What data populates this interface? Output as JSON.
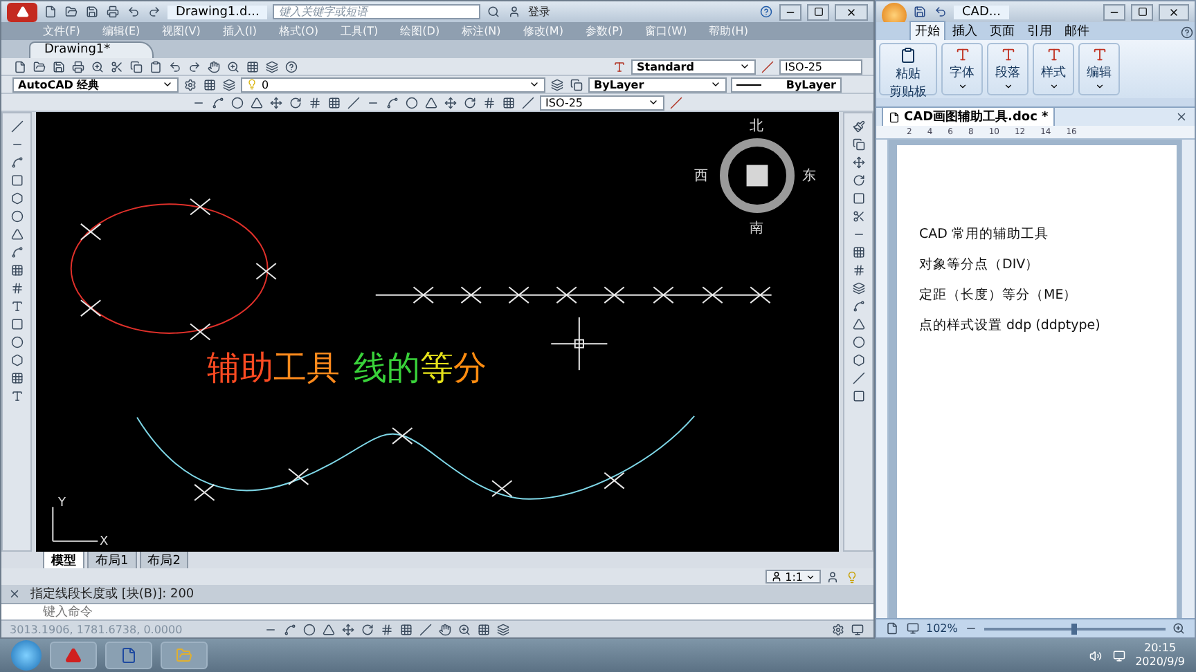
{
  "cad_window": {
    "title": "Drawing1.d...",
    "search": {
      "placeholder": "键入关键字或短语"
    },
    "login": "登录",
    "menu": [
      "文件(F)",
      "编辑(E)",
      "视图(V)",
      "插入(I)",
      "格式(O)",
      "工具(T)",
      "绘图(D)",
      "标注(N)",
      "修改(M)",
      "参数(P)",
      "窗口(W)",
      "帮助(H)"
    ],
    "doc_tabs": [
      {
        "label": "Drawing1*",
        "selected": true
      }
    ],
    "text_style": "Standard",
    "dim_style": "ISO-25",
    "workspace": "AutoCAD 经典",
    "layer": "0",
    "color_setting": "ByLayer",
    "linetype": "ByLayer",
    "dim_style_2": "ISO-25",
    "canvas": {
      "viewcube": {
        "north": "北",
        "west": "西",
        "east": "东",
        "south": "南"
      },
      "ucs": {
        "y": "Y",
        "x": "X"
      },
      "caption": [
        {
          "parts": [
            {
              "text": "辅助",
              "color": "#ff4b22"
            },
            {
              "text": "工具",
              "color": "#ff8a1c"
            }
          ]
        },
        {
          "parts": [
            {
              "text": "线的",
              "color": "#39d23a"
            },
            {
              "text": "等",
              "color": "#e6e21a"
            },
            {
              "text": "分",
              "color": "#ff8c10"
            }
          ]
        }
      ]
    },
    "layout_tabs": [
      {
        "label": "模型",
        "selected": true
      },
      {
        "label": "布局1",
        "selected": false
      },
      {
        "label": "布局2",
        "selected": false
      }
    ],
    "scale": "1:1",
    "command_history": "指定线段长度或 [块(B)]: 200",
    "command_input": {
      "placeholder": "键入命令"
    },
    "coordinates": "3013.1906, 1781.6738, 0.0000"
  },
  "word_window": {
    "title": "CAD...",
    "tabs": [
      {
        "label": "开始",
        "selected": true
      },
      {
        "label": "插入",
        "selected": false
      },
      {
        "label": "页面",
        "selected": false
      },
      {
        "label": "引用",
        "selected": false
      },
      {
        "label": "邮件",
        "selected": false
      }
    ],
    "paste": "粘贴",
    "clipboard": "剪贴板",
    "groups": [
      "字体",
      "段落",
      "样式",
      "编辑"
    ],
    "document_tab": "CAD画图辅助工具.doc *",
    "ruler": [
      "2",
      "4",
      "6",
      "8",
      "10",
      "12",
      "14",
      "16"
    ],
    "paragraphs": [
      "CAD 常用的辅助工具",
      "对象等分点（DIV）",
      "定距（长度）等分（ME）",
      "点的样式设置 ddp  (ddptype)"
    ],
    "zoom": "102%",
    "zoom_slider": {
      "level": 0.5
    }
  },
  "taskbar": {
    "time": "20:15",
    "date": "2020/9/9"
  }
}
